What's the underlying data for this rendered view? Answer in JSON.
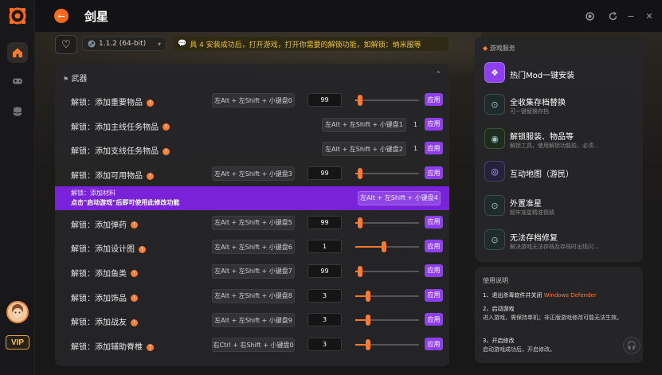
{
  "window": {
    "title": "剑星"
  },
  "game": {
    "version": "1.1.2 (64-bit)",
    "notice": "具 4 安装成功后，打开游戏，打开你需要的解锁功能，如解锁：纳米服等"
  },
  "section": {
    "title": "武器"
  },
  "rows": [
    {
      "label": "解锁：添加重要物品",
      "hotkey": "左Alt + 左Shift + 小键盘0",
      "value": "99",
      "slider": 0.08,
      "apply": "应用"
    },
    {
      "label": "解锁：添加主线任务物品",
      "hotkey": "左Alt + 左Shift + 小键盘1",
      "value": "1",
      "apply": "应用"
    },
    {
      "label": "解锁：添加支线任务物品",
      "hotkey": "左Alt + 左Shift + 小键盘2",
      "value": "1",
      "apply": "应用"
    },
    {
      "label": "解锁：添加可用物品",
      "hotkey": "左Alt + 左Shift + 小键盘3",
      "value": "99",
      "slider": 0.08,
      "apply": "应用"
    },
    {
      "label": "解锁：添加材料",
      "tip": "点击\"启动游戏\"后即可使用此修改功能",
      "hotkey": "左Alt + 左Shift + 小键盘4"
    },
    {
      "label": "解锁：添加弹药",
      "hotkey": "左Alt + 左Shift + 小键盘5",
      "value": "99",
      "slider": 0.08,
      "apply": "应用"
    },
    {
      "label": "解锁：添加设计图",
      "hotkey": "左Alt + 左Shift + 小键盘6",
      "value": "1",
      "slider": 0.45,
      "apply": "应用"
    },
    {
      "label": "解锁：添加鱼类",
      "hotkey": "左Alt + 左Shift + 小键盘7",
      "value": "99",
      "slider": 0.08,
      "apply": "应用"
    },
    {
      "label": "解锁：添加饰品",
      "hotkey": "左Alt + 左Shift + 小键盘8",
      "value": "3",
      "slider": 0.2,
      "apply": "应用"
    },
    {
      "label": "解锁：添加战友",
      "hotkey": "左Alt + 左Shift + 小键盘9",
      "value": "3",
      "slider": 0.2,
      "apply": "应用"
    },
    {
      "label": "解锁：添加辅助脊椎",
      "hotkey": "右Ctrl + 右Shift + 小键盘0",
      "value": "3",
      "slider": 0.2,
      "apply": "应用"
    }
  ],
  "services": {
    "title": "游戏服务",
    "items": [
      {
        "title": "热门Mod一键安装",
        "sub": "",
        "icon": "mod-icon"
      },
      {
        "title": "全收集存档替换",
        "sub": "可一键替换存档",
        "icon": "save-swap-icon"
      },
      {
        "title": "解锁服装、物品等",
        "sub": "解锁工具，使用解锁功能前，必须...",
        "icon": "unlock-icon"
      },
      {
        "title": "互动地图（游民）",
        "sub": "",
        "icon": "map-icon"
      },
      {
        "title": "外置准星",
        "sub": "超牢准星精准锁敌",
        "icon": "crosshair-icon"
      },
      {
        "title": "无法存档修复",
        "sub": "解决游戏无法存档及存档时出现闪...",
        "icon": "save-fix-icon"
      }
    ]
  },
  "usage": {
    "title": "使用说明",
    "s1_title": "1、退出杀毒软件并关闭",
    "s1_warn": "Windows Defender",
    "s2_title": "2、启动游戏",
    "s2_body": "进入游戏，需保持单机；非正版游戏修改可能无法生效。",
    "s3_title": "3、开启修改",
    "s3_body": "启动游戏成功后，开启修改。"
  },
  "vip_label": "VIP",
  "colors": {
    "accent": "#ff7a2e",
    "purple": "#8d3ff0",
    "highlight": "#7a22d9"
  }
}
